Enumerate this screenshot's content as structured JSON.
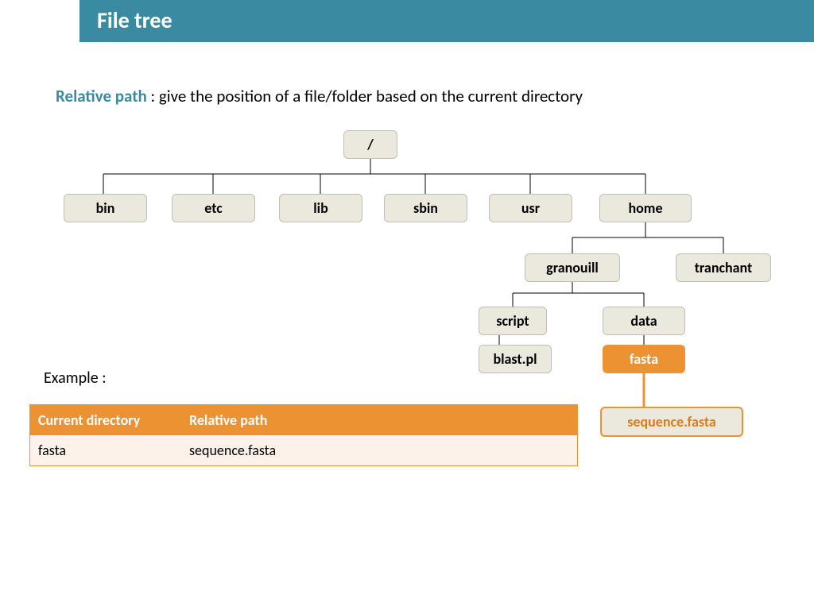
{
  "header": {
    "title": "File tree"
  },
  "description": {
    "term": "Relative path",
    "text": " : give the position of a file/folder based on the current directory"
  },
  "tree": {
    "root": "/",
    "level1": [
      "bin",
      "etc",
      "lib",
      "sbin",
      "usr",
      "home"
    ],
    "home_children": [
      "granouill",
      "tranchant"
    ],
    "granouill_children": [
      "script",
      "data"
    ],
    "script_child": "blast.pl",
    "data_child_highlighted": "fasta",
    "fasta_child_outlined": "sequence.fasta"
  },
  "example": {
    "label": "Example :",
    "headers": [
      "Current directory",
      "Relative path"
    ],
    "row": [
      "fasta",
      "sequence.fasta"
    ]
  },
  "colors": {
    "header_bg": "#3a8ba1",
    "node_bg": "#ebe9dd",
    "accent": "#ed9233"
  }
}
